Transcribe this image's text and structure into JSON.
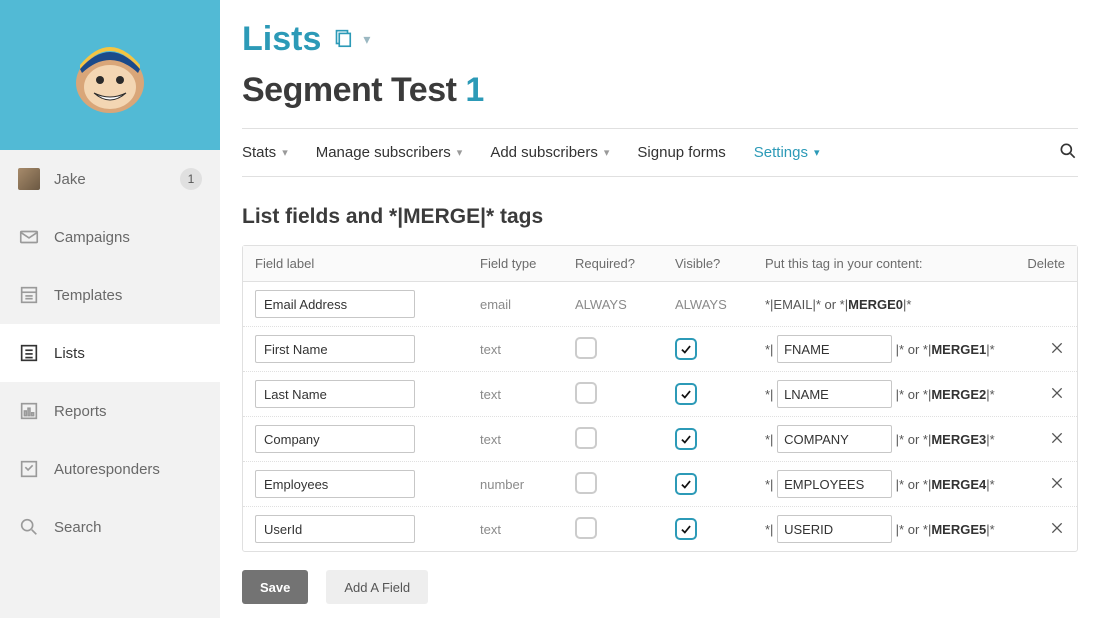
{
  "user": {
    "name": "Jake",
    "badge": "1"
  },
  "sidebar": {
    "items": [
      {
        "key": "campaigns",
        "label": "Campaigns"
      },
      {
        "key": "templates",
        "label": "Templates"
      },
      {
        "key": "lists",
        "label": "Lists"
      },
      {
        "key": "reports",
        "label": "Reports"
      },
      {
        "key": "autoresponders",
        "label": "Autoresponders"
      },
      {
        "key": "search",
        "label": "Search"
      }
    ]
  },
  "breadcrumb": {
    "title": "Lists"
  },
  "page": {
    "title": "Segment Test",
    "number": "1"
  },
  "tabs": {
    "stats": "Stats",
    "manage": "Manage subscribers",
    "add": "Add subscribers",
    "signup": "Signup forms",
    "settings": "Settings"
  },
  "section_title": "List fields and *|MERGE|* tags",
  "table": {
    "headers": {
      "label": "Field label",
      "type": "Field type",
      "required": "Required?",
      "visible": "Visible?",
      "tag": "Put this tag in your content:",
      "delete": "Delete"
    },
    "rows": [
      {
        "label": "Email Address",
        "type": "email",
        "required": "ALWAYS",
        "visible": "ALWAYS",
        "tag_fixed": "*|EMAIL|* or *|MERGE0|*",
        "merge": "MERGE0"
      },
      {
        "label": "First Name",
        "type": "text",
        "required": false,
        "visible": true,
        "tag": "FNAME",
        "merge": "MERGE1"
      },
      {
        "label": "Last Name",
        "type": "text",
        "required": false,
        "visible": true,
        "tag": "LNAME",
        "merge": "MERGE2"
      },
      {
        "label": "Company",
        "type": "text",
        "required": false,
        "visible": true,
        "tag": "COMPANY",
        "merge": "MERGE3"
      },
      {
        "label": "Employees",
        "type": "number",
        "required": false,
        "visible": true,
        "tag": "EMPLOYEES",
        "merge": "MERGE4"
      },
      {
        "label": "UserId",
        "type": "text",
        "required": false,
        "visible": true,
        "tag": "USERID",
        "merge": "MERGE5"
      }
    ]
  },
  "buttons": {
    "save": "Save",
    "add_field": "Add A Field"
  }
}
